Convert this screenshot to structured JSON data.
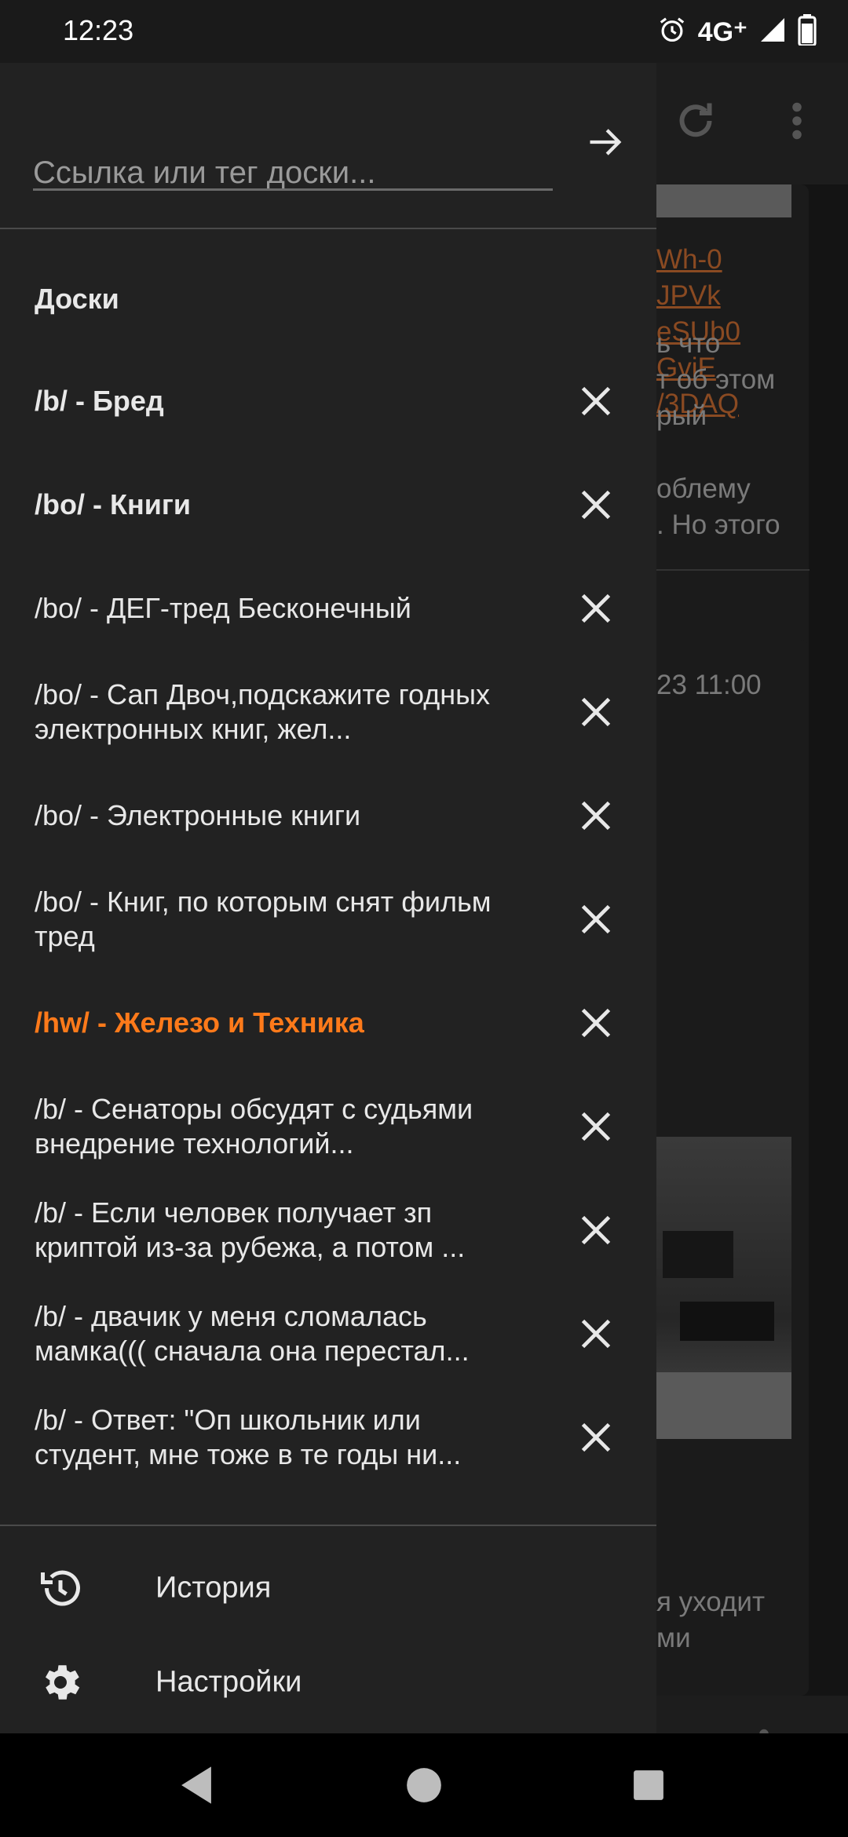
{
  "status": {
    "time": "12:23",
    "network": "4G⁺"
  },
  "drawer": {
    "search_placeholder": "Ссылка или тег доски...",
    "section_title": "Доски",
    "boards": [
      {
        "label": "/b/ - Бред",
        "style": "bold"
      },
      {
        "label": "/bo/ - Книги",
        "style": "bold"
      },
      {
        "label": "/bo/ - ДЕГ-тред Бесконечный",
        "style": "normal"
      },
      {
        "label": "/bo/ - Сап Двоч,подскажите годных электронных книг, жел...",
        "style": "normal"
      },
      {
        "label": "/bo/ - Электронные книги",
        "style": "normal"
      },
      {
        "label": "/bo/ - Книг, по которым снят фильм тред",
        "style": "normal"
      },
      {
        "label": "/hw/ - Железо и Техника",
        "style": "active"
      },
      {
        "label": "/b/ - Сенаторы обсудят с судьями внедрение технологий...",
        "style": "normal"
      },
      {
        "label": "/b/ - Если человек получает зп криптой из-за рубежа, а потом ...",
        "style": "normal"
      },
      {
        "label": "/b/ - двачик у меня сломалась мамка((( сначала она перестал...",
        "style": "normal"
      },
      {
        "label": "/b/ - Ответ: \"Оп школьник или студент, мне тоже в те годы ни...",
        "style": "normal"
      }
    ],
    "menu": {
      "history": "История",
      "settings": "Настройки"
    }
  },
  "background": {
    "links": [
      "Wh-0",
      "JPVk",
      "eSUb0",
      "GviE",
      "/3DAQ"
    ],
    "text_lines_1": [
      "ь что",
      "т об этом",
      "рый"
    ],
    "text_lines_2": [
      "облему",
      ". Но этого"
    ],
    "date": "23 11:00",
    "text_lines_3": [
      "я уходит",
      "ми"
    ]
  },
  "colors": {
    "accent": "#ff7a1a",
    "drawer_bg": "#222222",
    "link": "#8a4a22"
  }
}
